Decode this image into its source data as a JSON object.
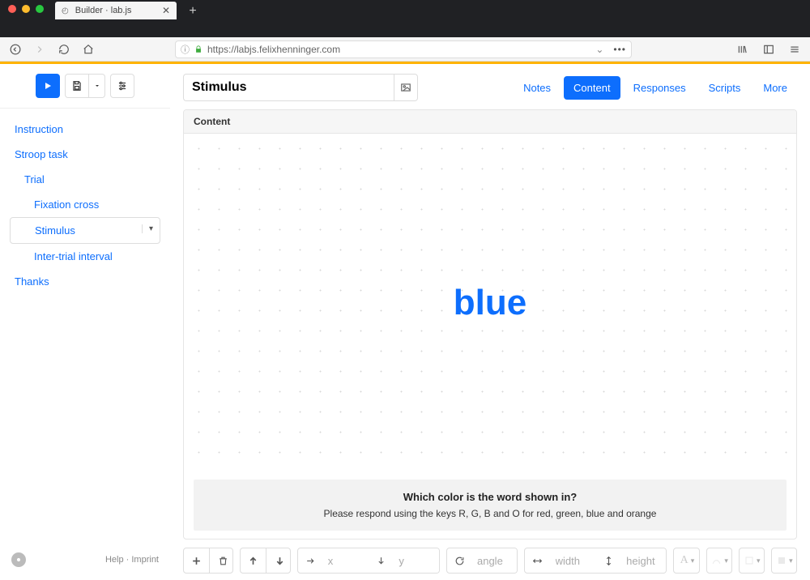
{
  "browser": {
    "tab_title": "Builder · lab.js",
    "url": "https://labjs.felixhenninger.com"
  },
  "sidebar": {
    "tree": [
      {
        "label": "Instruction",
        "level": 1,
        "selected": false
      },
      {
        "label": "Stroop task",
        "level": 1,
        "selected": false
      },
      {
        "label": "Trial",
        "level": 2,
        "selected": false
      },
      {
        "label": "Fixation cross",
        "level": 3,
        "selected": false
      },
      {
        "label": "Stimulus",
        "level": 3,
        "selected": true
      },
      {
        "label": "Inter-trial interval",
        "level": 3,
        "selected": false
      },
      {
        "label": "Thanks",
        "level": 1,
        "selected": false
      }
    ],
    "footer": {
      "help": "Help",
      "sep": "·",
      "imprint": "Imprint"
    }
  },
  "header": {
    "title_value": "Stimulus",
    "tabs": [
      {
        "label": "Notes",
        "active": false
      },
      {
        "label": "Content",
        "active": true
      },
      {
        "label": "Responses",
        "active": false
      },
      {
        "label": "Scripts",
        "active": false
      },
      {
        "label": "More",
        "active": false
      }
    ]
  },
  "panel": {
    "header": "Content",
    "stimulus_text": "blue",
    "stimulus_color": "#0d6efd",
    "prompt_title": "Which color is the word shown in?",
    "prompt_body": "Please respond using the keys R, G, B and O for red, green, blue and orange"
  },
  "toolbar": {
    "placeholders": {
      "x": "x",
      "y": "y",
      "angle": "angle",
      "width": "width",
      "height": "height"
    }
  }
}
